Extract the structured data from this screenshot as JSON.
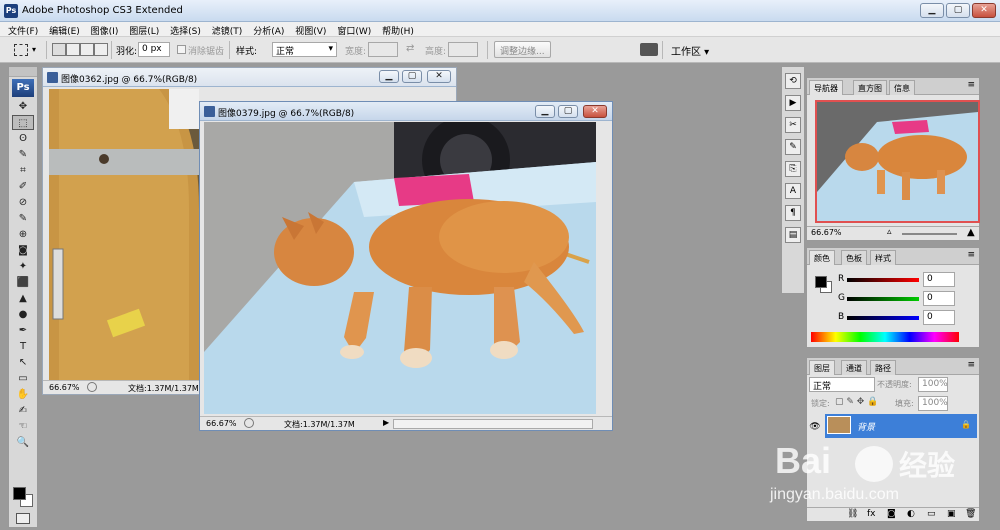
{
  "titlebar": {
    "logo": "Ps",
    "title": "Adobe Photoshop CS3 Extended",
    "minimize": "▁",
    "maximize": "▢",
    "close": "✕"
  },
  "menu": [
    "文件(F)",
    "编辑(E)",
    "图像(I)",
    "图层(L)",
    "选择(S)",
    "滤镜(T)",
    "分析(A)",
    "视图(V)",
    "窗口(W)",
    "帮助(H)"
  ],
  "options": {
    "feather_label": "羽化:",
    "feather_value": "0 px",
    "antialias_label": "消除锯齿",
    "style_label": "样式:",
    "style_value": "正常",
    "width_label": "宽度:",
    "height_label": "高度:",
    "refine_edge": "调整边缘...",
    "workspace": "工作区 ▾"
  },
  "tools": [
    "✥",
    "⬚",
    "ʘ",
    "✎",
    "⌗",
    "✐",
    "⊘",
    "✎",
    "⊕",
    "◙",
    "✦",
    "⬛",
    "▲",
    "●",
    "✒",
    "T",
    "↖",
    "▭",
    "✋",
    "✍",
    "☜",
    "🔍"
  ],
  "doc_back": {
    "title": "图像0362.jpg @ 66.7%(RGB/8)",
    "zoom": "66.67%",
    "docsize": "文档:1.37M/1.37M"
  },
  "doc_front": {
    "title": "图像0379.jpg @ 66.7%(RGB/8)",
    "zoom": "66.67%",
    "docsize": "文档:1.37M/1.37M",
    "arrow": "▶"
  },
  "navigator": {
    "tabs": [
      "导航器",
      "直方图",
      "信息"
    ],
    "zoom": "66.67%"
  },
  "color": {
    "tabs": [
      "颜色",
      "色板",
      "样式"
    ],
    "r_label": "R",
    "g_label": "G",
    "b_label": "B",
    "r_value": "0",
    "g_value": "0",
    "b_value": "0"
  },
  "layers": {
    "tabs": [
      "图层",
      "通道",
      "路径"
    ],
    "blend_mode": "正常",
    "opacity_label": "不透明度:",
    "opacity_value": "100%",
    "lock_label": "锁定:",
    "fill_label": "填充:",
    "fill_value": "100%",
    "layer_name": "背景"
  },
  "watermark": {
    "brand": "Bai",
    "brand2": "经验",
    "url": "jingyan.baidu.com"
  },
  "colors": {
    "accent": "#3d7fd8",
    "title_bg": "#c9dbef",
    "workspace": "#9a9a9a"
  }
}
